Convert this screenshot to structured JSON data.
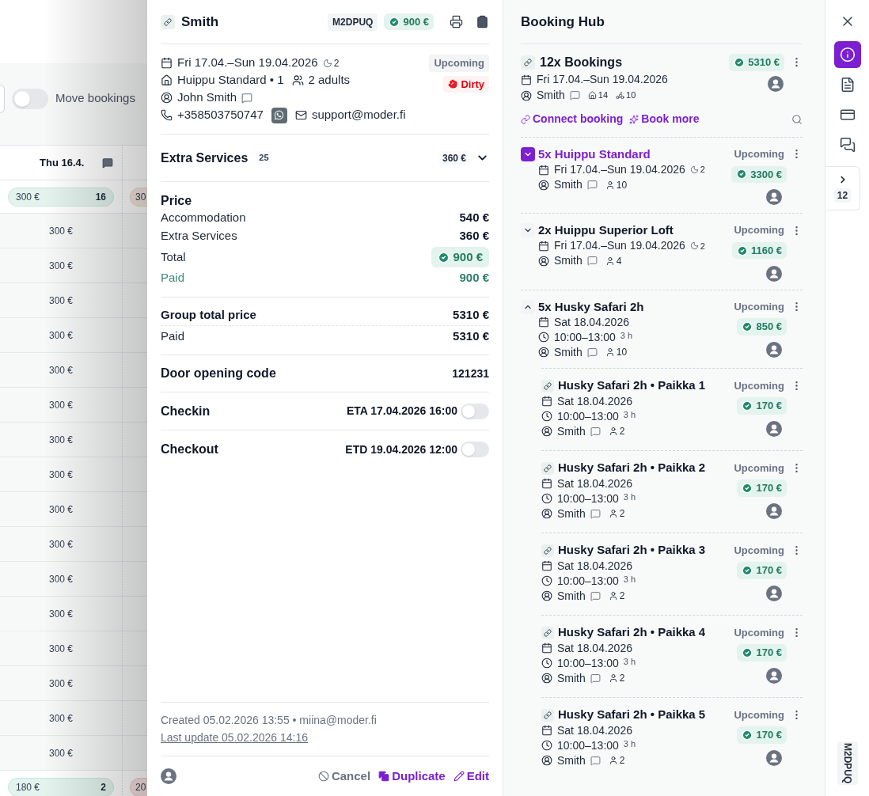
{
  "calendar": {
    "move_toggle": {
      "label": "Move bookings",
      "on": false
    },
    "day_header": "Thu 16.4.",
    "first_row": {
      "price": "300 €",
      "count": "16",
      "next_price": "30"
    },
    "cells": [
      "300 €",
      "300 €",
      "300 €",
      "300 €",
      "300 €",
      "300 €",
      "300 €",
      "300 €",
      "300 €",
      "300 €",
      "300 €",
      "300 €",
      "300 €",
      "300 €",
      "300 €",
      "300 €"
    ],
    "last_row": {
      "price": "180 €",
      "count": "2",
      "next_price": "20"
    }
  },
  "booking": {
    "title": "Smith",
    "code": "M2DPUQ",
    "amount": "900 €",
    "dates": "Fri 17.04.–Sun 19.04.2026",
    "nights": "2",
    "status": "Upcoming",
    "room": "Huippu Standard • 1",
    "guests": "2 adults",
    "housekeeping": "Dirty",
    "guest_name": "John Smith",
    "phone": "+358503750747",
    "email": "support@moder.fi"
  },
  "extra_services": {
    "label": "Extra Services",
    "count": "25",
    "amount": "360 €",
    "expanded": false
  },
  "price": {
    "title": "Price",
    "rows": [
      {
        "label": "Accommodation",
        "value": "540 €",
        "kind": "plain"
      },
      {
        "label": "Extra Services",
        "value": "360 €",
        "kind": "plain"
      },
      {
        "label": "Total",
        "value": "900 €",
        "kind": "total"
      },
      {
        "label": "Paid",
        "value": "900 €",
        "kind": "paid"
      }
    ]
  },
  "group_total": {
    "rows": [
      {
        "label": "Group total price",
        "value": "5310 €"
      },
      {
        "label": "Paid",
        "value": "5310 €"
      }
    ]
  },
  "door_code": {
    "label": "Door opening code",
    "value": "121231"
  },
  "check": [
    {
      "label": "Checkin",
      "time": "ETA 17.04.2026 16:00",
      "on": false
    },
    {
      "label": "Checkout",
      "time": "ETD 19.04.2026 12:00",
      "on": false
    }
  ],
  "footer": {
    "created": "Created 05.02.2026 13:55 • miina@moder.fi",
    "last_update": "Last update 05.02.2026 14:16",
    "actions": [
      {
        "label": "Cancel",
        "kind": "cancel"
      },
      {
        "label": "Duplicate",
        "kind": "duplicate"
      },
      {
        "label": "Edit",
        "kind": "edit"
      }
    ]
  },
  "hub": {
    "title": "Booking Hub",
    "group": {
      "title": "12x Bookings",
      "amount": "5310 €",
      "dates": "Fri 17.04.–Sun 19.04.2026",
      "guest": "Smith",
      "units": "14",
      "activities": "10",
      "links": [
        {
          "label": "Connect booking",
          "kind": "connect"
        },
        {
          "label": "Book more",
          "kind": "more"
        }
      ]
    },
    "items": [
      {
        "kind": "group",
        "title": "5x Huippu Standard",
        "selected": true,
        "expanded": false,
        "status": "Upcoming",
        "amount": "3300 €",
        "date": "Fri 17.04.–Sun 19.04.2026",
        "nights": "2",
        "guest": "Smith",
        "people": "10"
      },
      {
        "kind": "group",
        "title": "2x Huippu Superior Loft",
        "selected": false,
        "expanded": false,
        "status": "Upcoming",
        "amount": "1160 €",
        "date": "Fri 17.04.–Sun 19.04.2026",
        "nights": "2",
        "guest": "Smith",
        "people": "4"
      },
      {
        "kind": "group",
        "title": "5x Husky Safari 2h",
        "selected": false,
        "expanded": true,
        "status": "Upcoming",
        "amount": "850 €",
        "date": "Sat 18.04.2026",
        "time": "10:00–13:00",
        "duration": "3 h",
        "guest": "Smith",
        "people": "10",
        "children": [
          {
            "kind": "single",
            "title": "Husky Safari 2h • Paikka 1",
            "status": "Upcoming",
            "amount": "170 €",
            "date": "Sat 18.04.2026",
            "time": "10:00–13:00",
            "duration": "3 h",
            "guest": "Smith",
            "people": "2"
          },
          {
            "kind": "single",
            "title": "Husky Safari 2h • Paikka 2",
            "status": "Upcoming",
            "amount": "170 €",
            "date": "Sat 18.04.2026",
            "time": "10:00–13:00",
            "duration": "3 h",
            "guest": "Smith",
            "people": "2"
          },
          {
            "kind": "single",
            "title": "Husky Safari 2h • Paikka 3",
            "status": "Upcoming",
            "amount": "170 €",
            "date": "Sat 18.04.2026",
            "time": "10:00–13:00",
            "duration": "3 h",
            "guest": "Smith",
            "people": "2"
          },
          {
            "kind": "single",
            "title": "Husky Safari 2h • Paikka 4",
            "status": "Upcoming",
            "amount": "170 €",
            "date": "Sat 18.04.2026",
            "time": "10:00–13:00",
            "duration": "3 h",
            "guest": "Smith",
            "people": "2"
          },
          {
            "kind": "single",
            "title": "Husky Safari 2h • Paikka 5",
            "status": "Upcoming",
            "amount": "170 €",
            "date": "Sat 18.04.2026",
            "time": "10:00–13:00",
            "duration": "3 h",
            "guest": "Smith",
            "people": "2"
          }
        ]
      }
    ]
  },
  "rail": {
    "buttons": [
      {
        "kind": "info",
        "selected": true
      },
      {
        "kind": "invoice",
        "selected": false
      },
      {
        "kind": "payment",
        "selected": false
      },
      {
        "kind": "messages",
        "selected": false
      }
    ],
    "tab_count": "12",
    "code": "M2DPUQ"
  }
}
